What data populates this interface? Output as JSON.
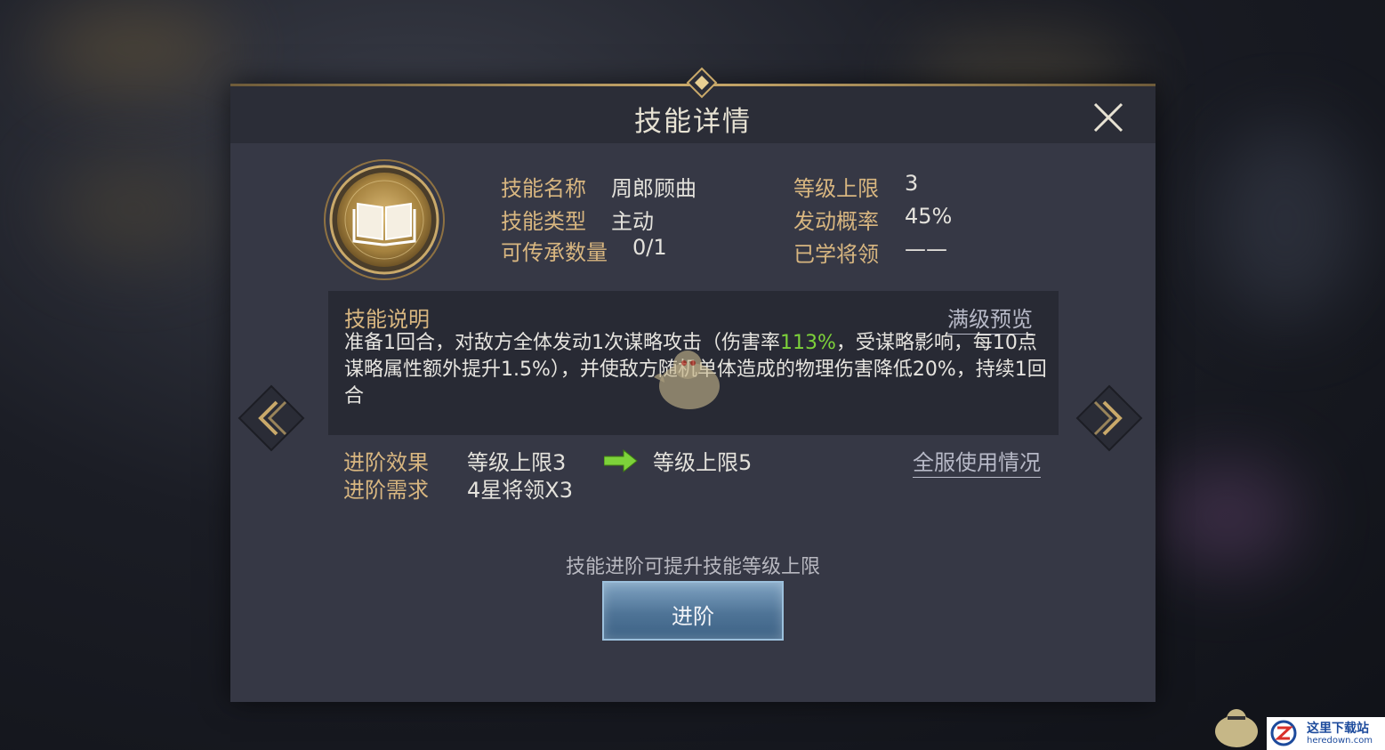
{
  "dialog": {
    "title": "技能详情"
  },
  "skill_info": {
    "name_label": "技能名称",
    "name_value": "周郎顾曲",
    "type_label": "技能类型",
    "type_value": "主动",
    "inherit_label": "可传承数量",
    "inherit_value": "0/1",
    "level_cap_label": "等级上限",
    "level_cap_value": "3",
    "trigger_rate_label": "发动概率",
    "trigger_rate_value": "45%",
    "learned_by_label": "已学将领",
    "learned_by_value": "——"
  },
  "description": {
    "title": "技能说明",
    "preview_link": "满级预览",
    "text_part1": "准备1回合，对敌方全体发动1次谋略攻击（伤害率",
    "damage_rate": "113%",
    "text_part2": "，受谋略影响，每10点谋略属性额外提升1.5%），并使敌方随机单体造成的物理伤害降低20%，持续1回合"
  },
  "advancement": {
    "effect_label": "进阶效果",
    "effect_from": "等级上限3",
    "effect_to": "等级上限5",
    "requirement_label": "进阶需求",
    "requirement_value": "4星将领X3",
    "usage_link": "全服使用情况",
    "hint": "技能进阶可提升技能等级上限",
    "button_label": "进阶"
  },
  "watermark": {
    "title": "这里下载站",
    "url": "heredown.com"
  },
  "icons": [
    "close-icon",
    "book-icon",
    "chevron-left-icon",
    "chevron-right-icon",
    "arrow-right-icon"
  ],
  "colors": {
    "gold": "#d8b680",
    "highlight_green": "#7dd23a",
    "panel_bg": "#363845",
    "button_blue": "#4f7497"
  }
}
